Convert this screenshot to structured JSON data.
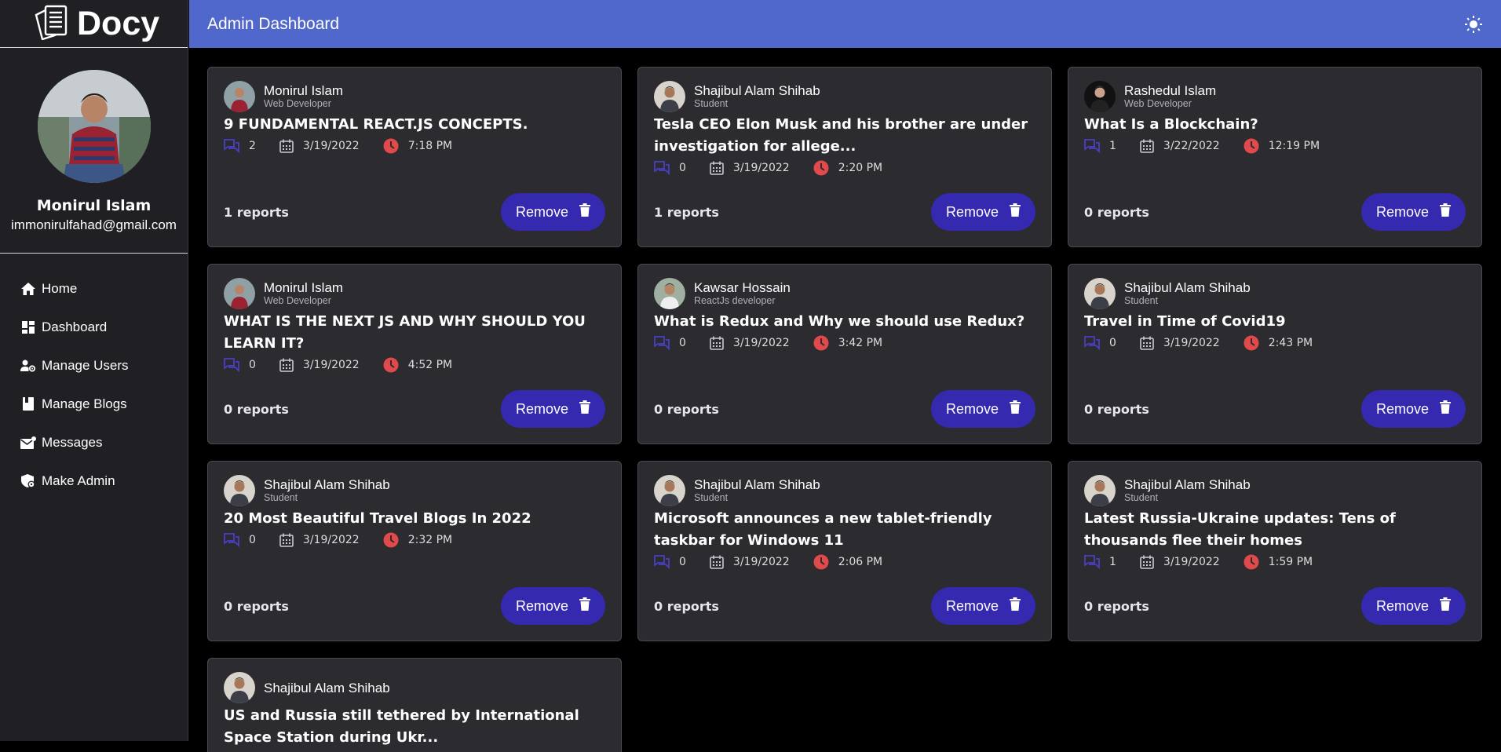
{
  "brand": {
    "name": "Docy"
  },
  "header": {
    "title": "Admin Dashboard"
  },
  "profile": {
    "name": "Monirul Islam",
    "email": "immonirulfahad@gmail.com"
  },
  "nav": [
    {
      "label": "Home",
      "icon": "home-icon"
    },
    {
      "label": "Dashboard",
      "icon": "dashboard-icon"
    },
    {
      "label": "Manage Users",
      "icon": "manage-users-icon"
    },
    {
      "label": "Manage Blogs",
      "icon": "book-icon"
    },
    {
      "label": "Messages",
      "icon": "mail-icon"
    },
    {
      "label": "Make Admin",
      "icon": "shield-icon"
    }
  ],
  "colors": {
    "accent": "#5068cc",
    "button": "#3529b0",
    "comment_icon": "#4a3fc4",
    "clock_icon": "#e04a4a"
  },
  "remove_label": "Remove",
  "blogs": [
    {
      "author": "Monirul Islam",
      "role": "Web Developer",
      "title": "9 FUNDAMENTAL REACT.JS CONCEPTS.",
      "comments": "2",
      "date": "3/19/2022",
      "time": "7:18 PM",
      "reports": "1 reports"
    },
    {
      "author": "Shajibul Alam Shihab",
      "role": "Student",
      "title": "Tesla CEO Elon Musk and his brother are under investigation for allege...",
      "comments": "0",
      "date": "3/19/2022",
      "time": "2:20 PM",
      "reports": "1 reports"
    },
    {
      "author": "Rashedul Islam",
      "role": "Web Developer",
      "title": "What Is a Blockchain?",
      "comments": "1",
      "date": "3/22/2022",
      "time": "12:19 PM",
      "reports": "0 reports"
    },
    {
      "author": "Monirul Islam",
      "role": "Web Developer",
      "title": "WHAT IS THE NEXT JS AND WHY SHOULD YOU LEARN IT?",
      "comments": "0",
      "date": "3/19/2022",
      "time": "4:52 PM",
      "reports": "0 reports"
    },
    {
      "author": "Kawsar Hossain",
      "role": "ReactJs developer",
      "title": "What is Redux and Why we should use Redux?",
      "comments": "0",
      "date": "3/19/2022",
      "time": "3:42 PM",
      "reports": "0 reports"
    },
    {
      "author": "Shajibul Alam Shihab",
      "role": "Student",
      "title": "Travel in Time of Covid19",
      "comments": "0",
      "date": "3/19/2022",
      "time": "2:43 PM",
      "reports": "0 reports"
    },
    {
      "author": "Shajibul Alam Shihab",
      "role": "Student",
      "title": "20 Most Beautiful Travel Blogs In 2022",
      "comments": "0",
      "date": "3/19/2022",
      "time": "2:32 PM",
      "reports": "0 reports"
    },
    {
      "author": "Shajibul Alam Shihab",
      "role": "Student",
      "title": "Microsoft announces a new tablet-friendly taskbar for Windows 11",
      "comments": "0",
      "date": "3/19/2022",
      "time": "2:06 PM",
      "reports": "0 reports"
    },
    {
      "author": "Shajibul Alam Shihab",
      "role": "Student",
      "title": "Latest Russia-Ukraine updates: Tens of thousands flee their homes",
      "comments": "1",
      "date": "3/19/2022",
      "time": "1:59 PM",
      "reports": "0 reports"
    },
    {
      "author": "Shajibul Alam Shihab",
      "role": "",
      "title": "US and Russia still tethered by International Space Station during Ukr..."
    }
  ]
}
